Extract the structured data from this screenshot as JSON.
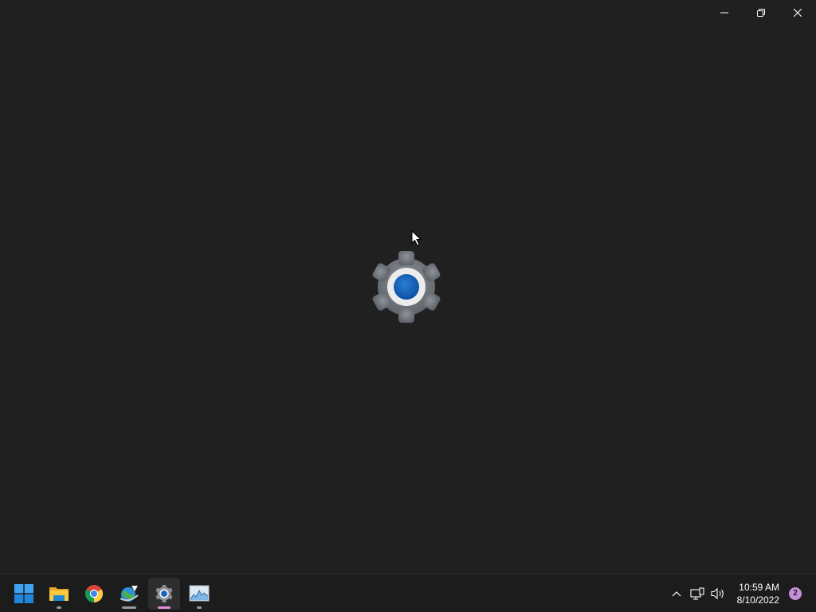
{
  "window": {
    "caption_buttons": [
      {
        "name": "minimize",
        "icon": "minimize-icon"
      },
      {
        "name": "restore",
        "icon": "restore-icon"
      },
      {
        "name": "close",
        "icon": "close-icon"
      }
    ],
    "splash_icon": "settings-gear-icon"
  },
  "taskbar": {
    "apps": [
      {
        "name": "start",
        "icon": "windows-logo-icon"
      },
      {
        "name": "file-explorer",
        "icon": "folder-icon"
      },
      {
        "name": "chrome",
        "icon": "chrome-icon"
      },
      {
        "name": "internet-download-manager",
        "icon": "download-globe-icon"
      },
      {
        "name": "settings",
        "icon": "settings-gear-icon"
      },
      {
        "name": "task-manager",
        "icon": "performance-chart-icon"
      }
    ],
    "tray": {
      "overflow_icon": "chevron-up-icon",
      "network_icon": "network-icon",
      "volume_icon": "volume-icon",
      "time": "10:59 AM",
      "date": "8/10/2022",
      "notification_count": "2"
    }
  },
  "colors": {
    "background": "#202020",
    "taskbar": "#1c1c1c",
    "accent_blue": "#1565c0",
    "active_indicator": "#e38fd8",
    "notification_badge": "#c48fd8"
  }
}
